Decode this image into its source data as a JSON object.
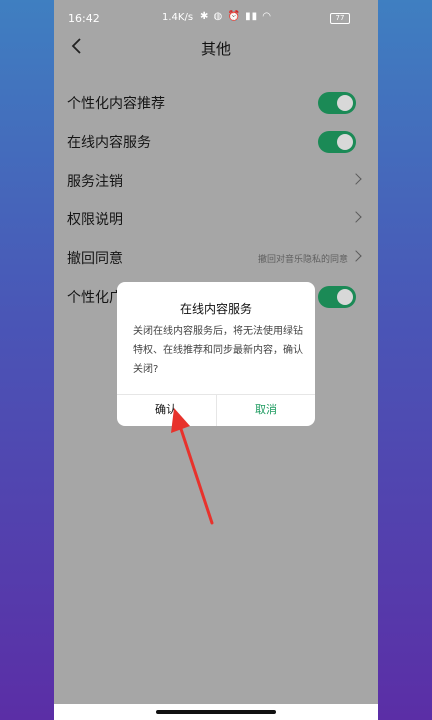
{
  "status_bar": {
    "time": "16:42",
    "network_speed": "1.4K/s",
    "icons": "✱ ◍ ⏰ ▮▮ ◠",
    "battery": "77"
  },
  "header": {
    "title": "其他"
  },
  "settings": [
    {
      "label": "个性化内容推荐",
      "type": "toggle",
      "on": true
    },
    {
      "label": "在线内容服务",
      "type": "toggle",
      "on": true
    },
    {
      "label": "服务注销",
      "type": "link"
    },
    {
      "label": "权限说明",
      "type": "link"
    },
    {
      "label": "撤回同意",
      "type": "link",
      "sub": "撤回对音乐隐私的同意"
    },
    {
      "label": "个性化广告推荐",
      "type": "toggle",
      "on": true
    }
  ],
  "dialog": {
    "title": "在线内容服务",
    "message": "关闭在线内容服务后，将无法使用绿钻特权、在线推荐和同步最新内容，确认关闭?",
    "confirm_label": "确认",
    "cancel_label": "取消"
  },
  "colors": {
    "accent": "#1b9a5e",
    "toggle_on": "#1b8a56",
    "annotation_arrow": "#e8322c"
  },
  "icons": {
    "back": "chevron-left-icon",
    "row_arrow": "chevron-right-icon"
  }
}
